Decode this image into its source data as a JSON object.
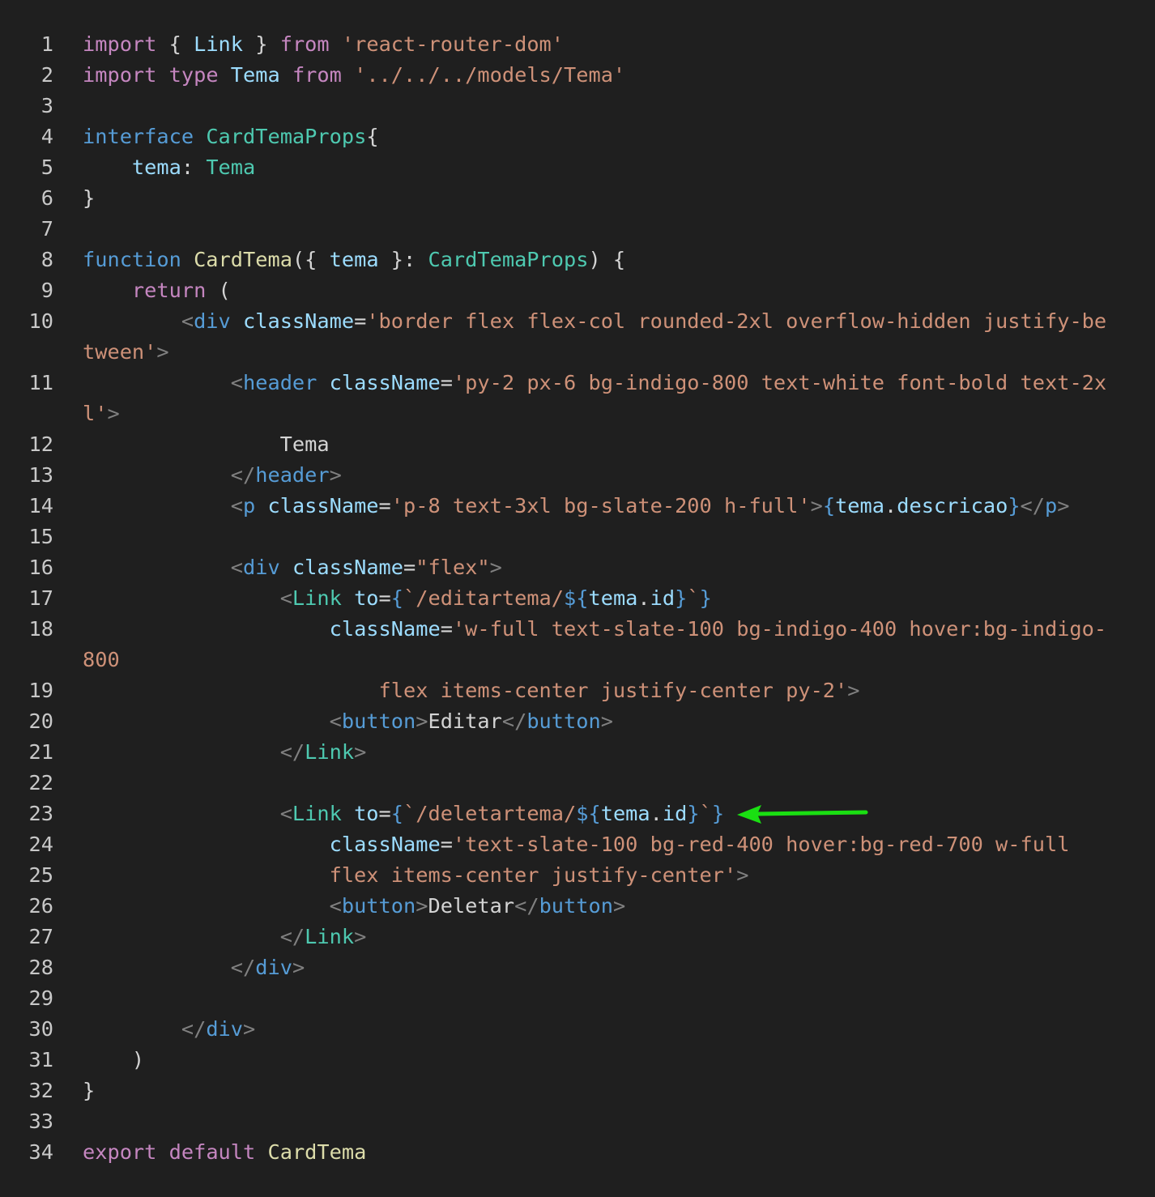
{
  "language": "tsx",
  "arrow_color": "#1adf12",
  "colors": {
    "background": "#1f1f1f",
    "keyword": "#c586c0",
    "declaration": "#569cd6",
    "type": "#4ec9b0",
    "function": "#dcdcaa",
    "variable": "#9cdcfe",
    "string": "#ce9178",
    "tag_punctuation": "#808080"
  },
  "lines": [
    {
      "n": "1",
      "tokens": [
        [
          "kw",
          "import"
        ],
        [
          "pl",
          " { "
        ],
        [
          "vr",
          "Link"
        ],
        [
          "pl",
          " } "
        ],
        [
          "kw",
          "from"
        ],
        [
          "pl",
          " "
        ],
        [
          "st",
          "'react-router-dom'"
        ]
      ]
    },
    {
      "n": "2",
      "tokens": [
        [
          "kw",
          "import"
        ],
        [
          "pl",
          " "
        ],
        [
          "kw",
          "type"
        ],
        [
          "pl",
          " "
        ],
        [
          "vr",
          "Tema"
        ],
        [
          "pl",
          " "
        ],
        [
          "kw",
          "from"
        ],
        [
          "pl",
          " "
        ],
        [
          "st",
          "'../../../models/Tema'"
        ]
      ]
    },
    {
      "n": "3",
      "tokens": []
    },
    {
      "n": "4",
      "tokens": [
        [
          "bl",
          "interface"
        ],
        [
          "pl",
          " "
        ],
        [
          "tp",
          "CardTemaProps"
        ],
        [
          "pl",
          "{"
        ]
      ]
    },
    {
      "n": "5",
      "tokens": [
        [
          "pl",
          "    "
        ],
        [
          "vr",
          "tema"
        ],
        [
          "pl",
          ": "
        ],
        [
          "tp",
          "Tema"
        ]
      ]
    },
    {
      "n": "6",
      "tokens": [
        [
          "pl",
          "}"
        ]
      ]
    },
    {
      "n": "7",
      "tokens": []
    },
    {
      "n": "8",
      "tokens": [
        [
          "bl",
          "function"
        ],
        [
          "pl",
          " "
        ],
        [
          "fn",
          "CardTema"
        ],
        [
          "pl",
          "({ "
        ],
        [
          "vr",
          "tema"
        ],
        [
          "pl",
          " }: "
        ],
        [
          "tp",
          "CardTemaProps"
        ],
        [
          "pl",
          ") {"
        ]
      ]
    },
    {
      "n": "9",
      "tokens": [
        [
          "pl",
          "    "
        ],
        [
          "kw",
          "return"
        ],
        [
          "pl",
          " ("
        ]
      ]
    },
    {
      "n": "10",
      "tokens": [
        [
          "pl",
          "        "
        ],
        [
          "pn",
          "<"
        ],
        [
          "tg",
          "div"
        ],
        [
          "pl",
          " "
        ],
        [
          "vr",
          "className"
        ],
        [
          "pl",
          "="
        ],
        [
          "st",
          "'border flex flex-col rounded-2xl overflow-hidden justify-be"
        ]
      ]
    },
    {
      "n": "",
      "tokens": [
        [
          "st",
          "tween'"
        ],
        [
          "pn",
          ">"
        ]
      ]
    },
    {
      "n": "11",
      "tokens": [
        [
          "pl",
          "            "
        ],
        [
          "pn",
          "<"
        ],
        [
          "tg",
          "header"
        ],
        [
          "pl",
          " "
        ],
        [
          "vr",
          "className"
        ],
        [
          "pl",
          "="
        ],
        [
          "st",
          "'py-2 px-6 bg-indigo-800 text-white font-bold text-2x"
        ]
      ]
    },
    {
      "n": "",
      "tokens": [
        [
          "st",
          "l'"
        ],
        [
          "pn",
          ">"
        ]
      ]
    },
    {
      "n": "12",
      "tokens": [
        [
          "pl",
          "                Tema"
        ]
      ]
    },
    {
      "n": "13",
      "tokens": [
        [
          "pl",
          "            "
        ],
        [
          "pn",
          "</"
        ],
        [
          "tg",
          "header"
        ],
        [
          "pn",
          ">"
        ]
      ]
    },
    {
      "n": "14",
      "tokens": [
        [
          "pl",
          "            "
        ],
        [
          "pn",
          "<"
        ],
        [
          "tg",
          "p"
        ],
        [
          "pl",
          " "
        ],
        [
          "vr",
          "className"
        ],
        [
          "pl",
          "="
        ],
        [
          "st",
          "'p-8 text-3xl bg-slate-200 h-full'"
        ],
        [
          "pn",
          ">"
        ],
        [
          "bl",
          "{"
        ],
        [
          "vr",
          "tema"
        ],
        [
          "pl",
          "."
        ],
        [
          "vr",
          "descricao"
        ],
        [
          "bl",
          "}"
        ],
        [
          "pn",
          "</"
        ],
        [
          "tg",
          "p"
        ],
        [
          "pn",
          ">"
        ]
      ]
    },
    {
      "n": "15",
      "tokens": []
    },
    {
      "n": "16",
      "tokens": [
        [
          "pl",
          "            "
        ],
        [
          "pn",
          "<"
        ],
        [
          "tg",
          "div"
        ],
        [
          "pl",
          " "
        ],
        [
          "vr",
          "className"
        ],
        [
          "pl",
          "="
        ],
        [
          "st",
          "\"flex\""
        ],
        [
          "pn",
          ">"
        ]
      ]
    },
    {
      "n": "17",
      "tokens": [
        [
          "pl",
          "                "
        ],
        [
          "pn",
          "<"
        ],
        [
          "tp",
          "Link"
        ],
        [
          "pl",
          " "
        ],
        [
          "vr",
          "to"
        ],
        [
          "pl",
          "="
        ],
        [
          "bl",
          "{"
        ],
        [
          "st",
          "`/editartema/"
        ],
        [
          "bl",
          "${"
        ],
        [
          "vr",
          "tema"
        ],
        [
          "pl",
          "."
        ],
        [
          "vr",
          "id"
        ],
        [
          "bl",
          "}"
        ],
        [
          "st",
          "`"
        ],
        [
          "bl",
          "}"
        ]
      ]
    },
    {
      "n": "18",
      "tokens": [
        [
          "pl",
          "                    "
        ],
        [
          "vr",
          "className"
        ],
        [
          "pl",
          "="
        ],
        [
          "st",
          "'w-full text-slate-100 bg-indigo-400 hover:bg-indigo-"
        ]
      ]
    },
    {
      "n": "",
      "tokens": [
        [
          "st",
          "800"
        ]
      ]
    },
    {
      "n": "19",
      "tokens": [
        [
          "st",
          "                        flex items-center justify-center py-2'"
        ],
        [
          "pn",
          ">"
        ]
      ]
    },
    {
      "n": "20",
      "tokens": [
        [
          "pl",
          "                    "
        ],
        [
          "pn",
          "<"
        ],
        [
          "tg",
          "button"
        ],
        [
          "pn",
          ">"
        ],
        [
          "pl",
          "Editar"
        ],
        [
          "pn",
          "</"
        ],
        [
          "tg",
          "button"
        ],
        [
          "pn",
          ">"
        ]
      ]
    },
    {
      "n": "21",
      "tokens": [
        [
          "pl",
          "                "
        ],
        [
          "pn",
          "</"
        ],
        [
          "tp",
          "Link"
        ],
        [
          "pn",
          ">"
        ]
      ]
    },
    {
      "n": "22",
      "tokens": []
    },
    {
      "n": "23",
      "tokens": [
        [
          "pl",
          "                "
        ],
        [
          "pn",
          "<"
        ],
        [
          "tp",
          "Link"
        ],
        [
          "pl",
          " "
        ],
        [
          "vr",
          "to"
        ],
        [
          "pl",
          "="
        ],
        [
          "bl",
          "{"
        ],
        [
          "st",
          "`/deletartema/"
        ],
        [
          "bl",
          "${"
        ],
        [
          "vr",
          "tema"
        ],
        [
          "pl",
          "."
        ],
        [
          "vr",
          "id"
        ],
        [
          "bl",
          "}"
        ],
        [
          "st",
          "`"
        ],
        [
          "bl",
          "}"
        ]
      ]
    },
    {
      "n": "24",
      "tokens": [
        [
          "pl",
          "                    "
        ],
        [
          "vr",
          "className"
        ],
        [
          "pl",
          "="
        ],
        [
          "st",
          "'text-slate-100 bg-red-400 hover:bg-red-700 w-full"
        ]
      ]
    },
    {
      "n": "25",
      "tokens": [
        [
          "st",
          "                    flex items-center justify-center'"
        ],
        [
          "pn",
          ">"
        ]
      ]
    },
    {
      "n": "26",
      "tokens": [
        [
          "pl",
          "                    "
        ],
        [
          "pn",
          "<"
        ],
        [
          "tg",
          "button"
        ],
        [
          "pn",
          ">"
        ],
        [
          "pl",
          "Deletar"
        ],
        [
          "pn",
          "</"
        ],
        [
          "tg",
          "button"
        ],
        [
          "pn",
          ">"
        ]
      ]
    },
    {
      "n": "27",
      "tokens": [
        [
          "pl",
          "                "
        ],
        [
          "pn",
          "</"
        ],
        [
          "tp",
          "Link"
        ],
        [
          "pn",
          ">"
        ]
      ]
    },
    {
      "n": "28",
      "tokens": [
        [
          "pl",
          "            "
        ],
        [
          "pn",
          "</"
        ],
        [
          "tg",
          "div"
        ],
        [
          "pn",
          ">"
        ]
      ]
    },
    {
      "n": "29",
      "tokens": []
    },
    {
      "n": "30",
      "tokens": [
        [
          "pl",
          "        "
        ],
        [
          "pn",
          "</"
        ],
        [
          "tg",
          "div"
        ],
        [
          "pn",
          ">"
        ]
      ]
    },
    {
      "n": "31",
      "tokens": [
        [
          "pl",
          "    )"
        ]
      ]
    },
    {
      "n": "32",
      "tokens": [
        [
          "pl",
          "}"
        ]
      ]
    },
    {
      "n": "33",
      "tokens": []
    },
    {
      "n": "34",
      "tokens": [
        [
          "kw",
          "export"
        ],
        [
          "pl",
          " "
        ],
        [
          "kw",
          "default"
        ],
        [
          "pl",
          " "
        ],
        [
          "fn",
          "CardTema"
        ]
      ]
    }
  ]
}
